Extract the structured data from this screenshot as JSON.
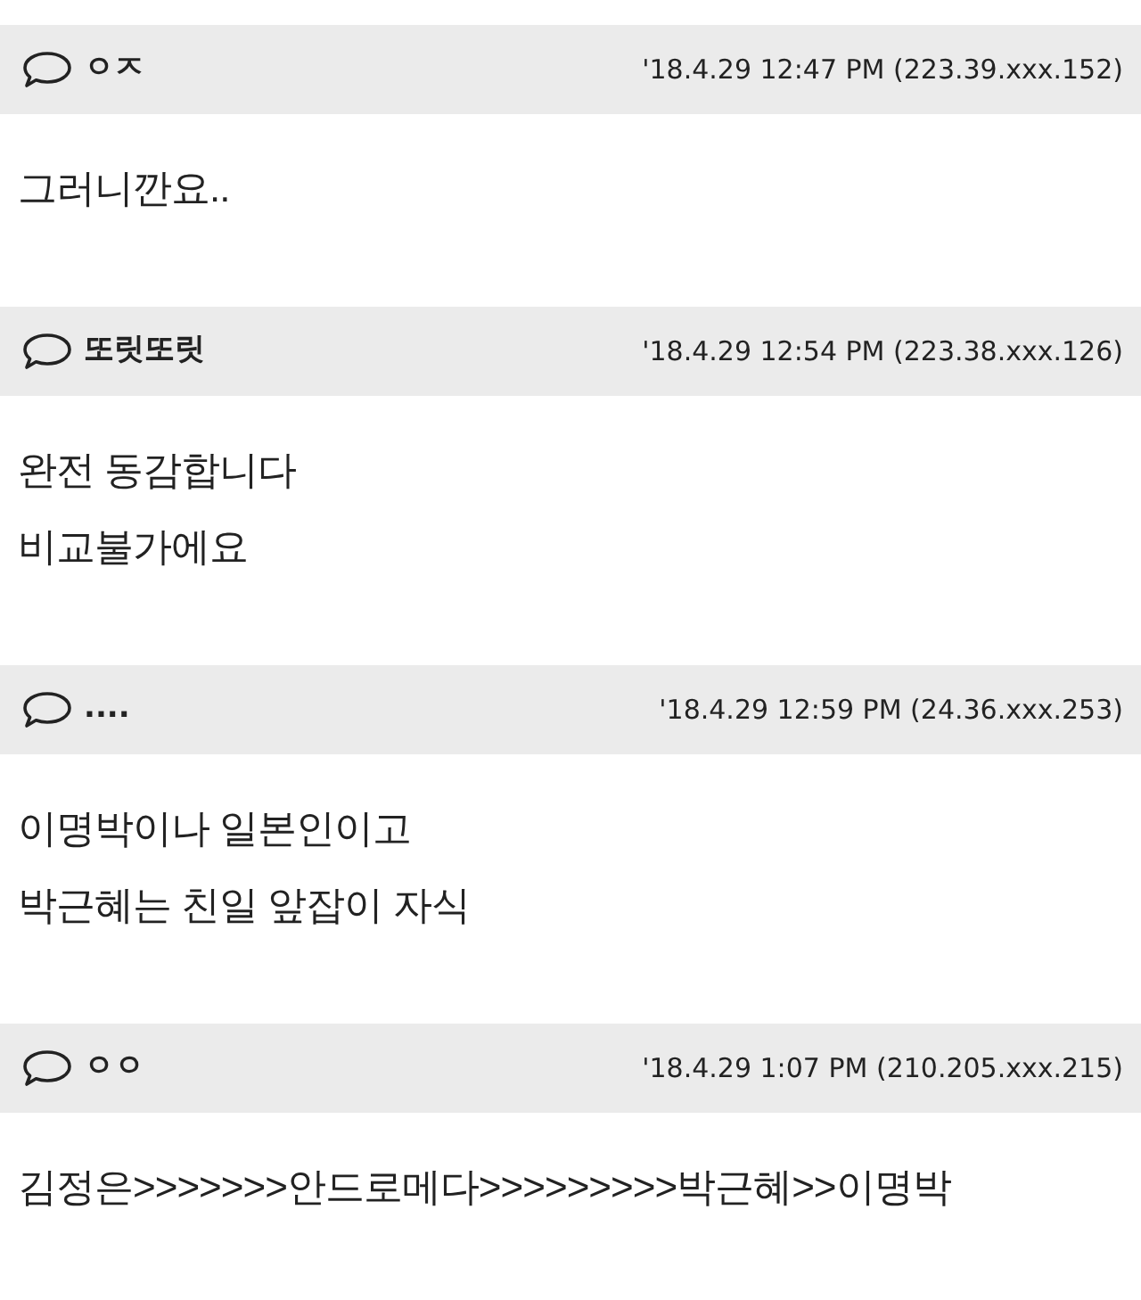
{
  "comments": [
    {
      "author": "ㅇㅈ",
      "meta": "'18.4.29 12:47 PM (223.39.xxx.152)",
      "lines": [
        "그러니깐요.."
      ]
    },
    {
      "author": "또릿또릿",
      "meta": "'18.4.29 12:54 PM (223.38.xxx.126)",
      "lines": [
        "완전 동감합니다",
        "비교불가에요"
      ]
    },
    {
      "author": "....",
      "meta": "'18.4.29 12:59 PM (24.36.xxx.253)",
      "lines": [
        "이명박이나 일본인이고",
        "박근혜는 친일 앞잡이 자식"
      ]
    },
    {
      "author": "ㅇㅇ",
      "meta": "'18.4.29 1:07 PM (210.205.xxx.215)",
      "lines": [
        "김정은>>>>>>>안드로메다>>>>>>>>>박근혜>>이명박"
      ]
    }
  ]
}
